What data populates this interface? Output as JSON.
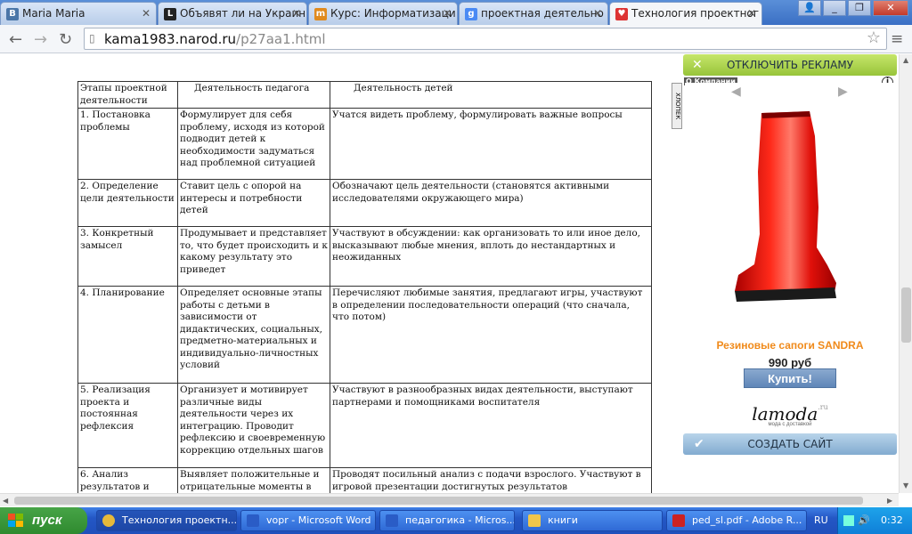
{
  "browser": {
    "tabs": [
      {
        "label": "Maria Maria",
        "favicon": "vk-icon",
        "color": "#4a76a8",
        "glyph": "B"
      },
      {
        "label": "Объявят ли на Украин",
        "favicon": "l-icon",
        "color": "#222222",
        "glyph": "L"
      },
      {
        "label": "Курс: Информатизаци",
        "favicon": "moodle-icon",
        "color": "#e08a1e",
        "glyph": "m"
      },
      {
        "label": "проектная деятельно",
        "favicon": "google-icon",
        "color": "#4a8af4",
        "glyph": "g"
      },
      {
        "label": "Технология проектног",
        "favicon": "heart-icon",
        "color": "#d33",
        "glyph": "♥"
      }
    ],
    "url_host": "kama1983.narod.ru",
    "url_path": "/p27aa1.html"
  },
  "table": {
    "headers": [
      "Этапы проектной деятельности",
      "Деятельность педагога",
      "Деятельность детей"
    ],
    "rows": [
      [
        "1. Постановка проблемы",
        "Формулирует для себя проблему, исходя из которой подводит детей к необходимости задуматься над проблемной ситуацией",
        "Учатся видеть проблему, формулировать важные вопросы"
      ],
      [
        "2. Определение цели деятельности",
        "Ставит цель с опорой на интересы и потребности детей",
        "Обозначают цель деятельности (становятся активными исследователями окружающего мира)"
      ],
      [
        "3. Конкретный замысел",
        "Продумывает и представляет то, что будет происходить и к какому результату это приведет",
        "Участвуют в обсуждении: как организовать то или иное дело, высказывают любые мнения, вплоть до нестандартных и неожиданных"
      ],
      [
        "4. Планирование",
        "Определяет основные этапы работы с детьми в зависимости от дидактических, социальных, предметно-материальных и индивидуально-личностных условий",
        "Перечисляют любимые занятия, предлагают игры, участвуют в определении последовательности операций (что сначала, что потом)"
      ],
      [
        "5. Реализация проекта и постоянная рефлексия",
        "Организует и мотивирует различные виды деятельности через их интеграцию. Проводит рефлексию и своевременную коррекцию отдельных шагов",
        "Участвуют в разнообразных видах деятельности, выступают партнерами и помощниками воспитателя"
      ],
      [
        "6. Анализ результатов и",
        "Выявляет положительные и отрицательные моменты в",
        "Проводят посильный анализ с подачи взрослого. Участвуют в игровой презентации достигнутых результатов"
      ]
    ]
  },
  "ads": {
    "disable_label": "ОТКЛЮЧИТЬ РЕКЛАМУ",
    "about_label": "О Компании",
    "side_label": "ХЛОПЕК",
    "product_title": "Резиновые сапоги SANDRA",
    "price": "990 руб",
    "buy_label": "Купить!",
    "brand": "lamoda",
    "brand_suffix": ".ru",
    "brand_tagline": "мода с доставкой",
    "create_site_label": "СОЗДАТЬ САЙТ"
  },
  "taskbar": {
    "start_label": "пуск",
    "tasks": [
      {
        "label": "Технология проектн...",
        "icon": "chrome-icon",
        "color": "#e6b93a"
      },
      {
        "label": "vopr - Microsoft Word",
        "icon": "word-icon",
        "color": "#2a5cc6"
      },
      {
        "label": "педагогика - Micros...",
        "icon": "word-icon",
        "color": "#2a5cc6"
      },
      {
        "label": "книги",
        "icon": "folder-icon",
        "color": "#f0c64a"
      },
      {
        "label": "ped_sl.pdf - Adobe R...",
        "icon": "pdf-icon",
        "color": "#c22"
      }
    ],
    "language": "RU",
    "clock": "0:32"
  }
}
